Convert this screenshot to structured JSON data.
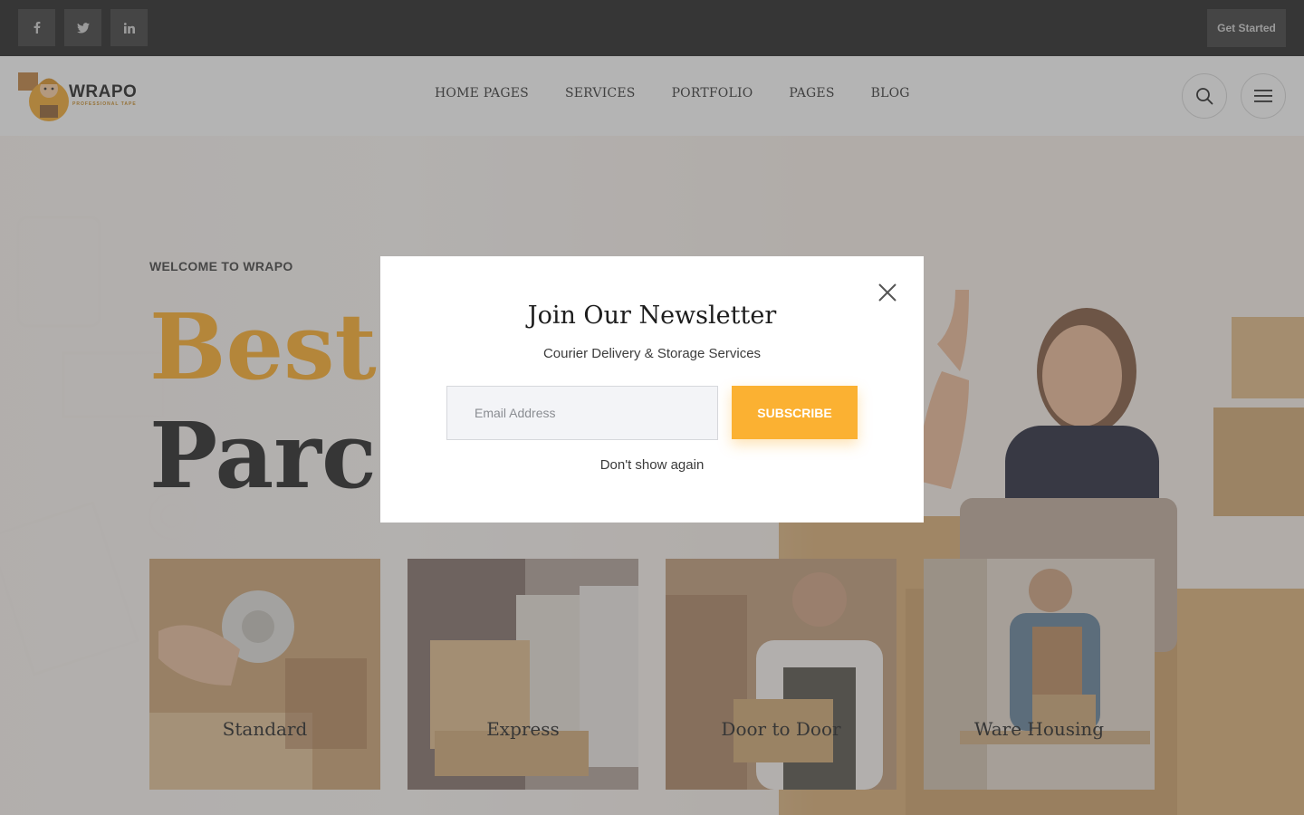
{
  "topbar": {
    "social": [
      {
        "icon": "facebook-icon"
      },
      {
        "icon": "twitter-icon"
      },
      {
        "icon": "linkedin-icon"
      }
    ],
    "cta_label": "Get Started"
  },
  "header": {
    "logo_text": "WRAPO",
    "logo_tagline": "PROFESSIONAL TAPE",
    "nav": [
      "HOME PAGES",
      "SERVICES",
      "PORTFOLIO",
      "PAGES",
      "BLOG"
    ],
    "icons": [
      "search-icon",
      "menu-icon"
    ]
  },
  "hero": {
    "welcome": "WELCOME TO WRAPO",
    "title_line1": "Best C",
    "title_line2": "Parce",
    "cards": [
      {
        "label": "Standard"
      },
      {
        "label": "Express"
      },
      {
        "label": "Door to Door"
      },
      {
        "label": "Ware Housing"
      }
    ]
  },
  "modal": {
    "title": "Join Our Newsletter",
    "subtitle": "Courier Delivery & Storage Services",
    "email_placeholder": "Email Address",
    "subscribe_label": "SUBSCRIBE",
    "dont_show_label": "Don't show again"
  },
  "colors": {
    "accent": "#fbb132",
    "dark": "#1d1d1d",
    "headline_accent": "#f5a524"
  }
}
